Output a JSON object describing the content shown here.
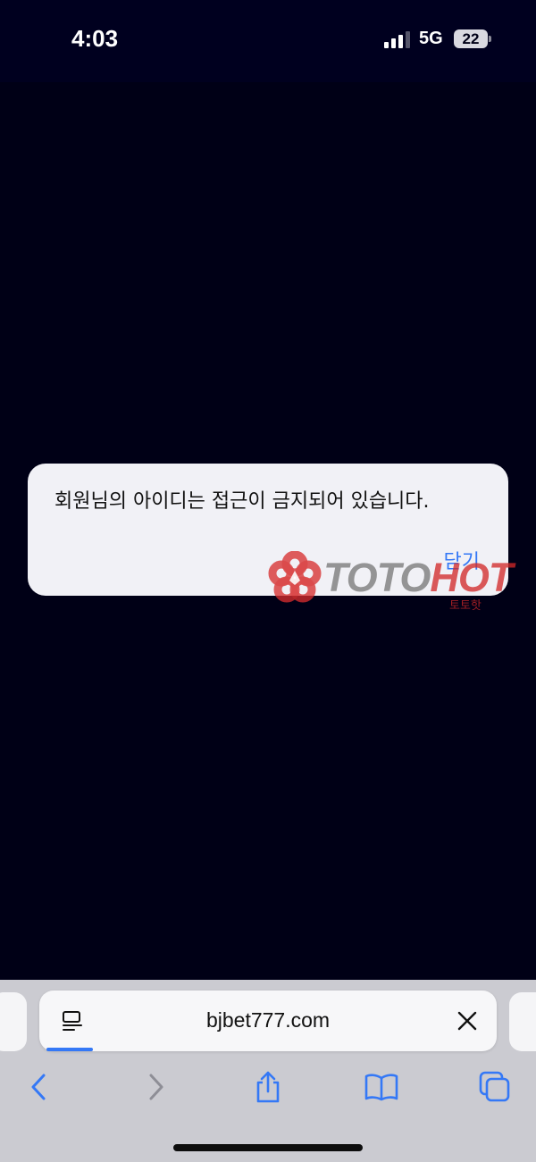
{
  "status_bar": {
    "time": "4:03",
    "network": "5G",
    "battery": "22",
    "signal_icon": "signal-bars-icon",
    "battery_icon": "battery-icon"
  },
  "alert": {
    "message": "회원님의 아이디는 접근이 금지되어 있습니다.",
    "close_label": "닫기"
  },
  "watermark": {
    "brand_part1": "TOTO",
    "brand_part2": "HOT",
    "subtitle": "토토핫",
    "logo_icon": "flower-logo-icon"
  },
  "browser": {
    "url": "bjbet777.com",
    "reader_icon": "page-menu-icon",
    "clear_icon": "close-icon",
    "toolbar_icons": [
      "back-icon",
      "forward-icon",
      "share-icon",
      "bookmarks-icon",
      "tabs-icon"
    ]
  },
  "colors": {
    "page_background": "#000016",
    "accent": "#3478f6",
    "dialog_background": "#f1f1f6",
    "toolbar_background": "#cbcbd1"
  }
}
